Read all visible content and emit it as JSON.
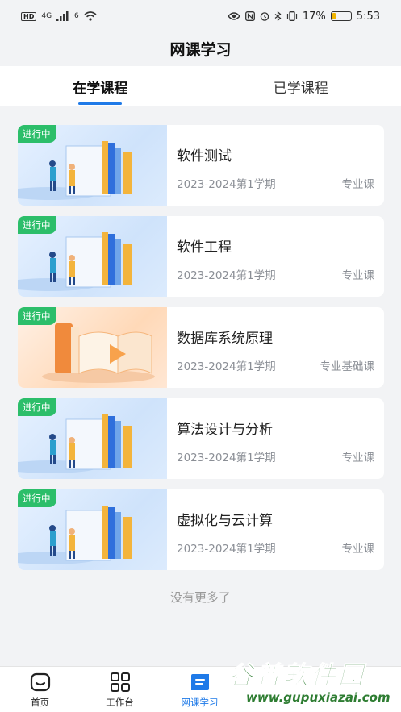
{
  "status_bar": {
    "hd": "HD",
    "net": "4G",
    "wifi_label": "6",
    "battery_percent": "17%",
    "battery_level": 0.17,
    "time": "5:53"
  },
  "header": {
    "title": "网课学习"
  },
  "tabs": [
    {
      "label": "在学课程",
      "active": true
    },
    {
      "label": "已学课程",
      "active": false
    }
  ],
  "courses": [
    {
      "status": "进行中",
      "name": "软件测试",
      "term": "2023-2024第1学期",
      "type": "专业课",
      "image": "books-illustration"
    },
    {
      "status": "进行中",
      "name": "软件工程",
      "term": "2023-2024第1学期",
      "type": "专业课",
      "image": "books-illustration"
    },
    {
      "status": "进行中",
      "name": "数据库系统原理",
      "term": "2023-2024第1学期",
      "type": "专业基础课",
      "image": "book-play-illustration"
    },
    {
      "status": "进行中",
      "name": "算法设计与分析",
      "term": "2023-2024第1学期",
      "type": "专业课",
      "image": "books-illustration"
    },
    {
      "status": "进行中",
      "name": "虚拟化与云计算",
      "term": "2023-2024第1学期",
      "type": "专业课",
      "image": "books-illustration"
    }
  ],
  "footer_text": "没有更多了",
  "bottom_nav": [
    {
      "label": "首页",
      "icon": "home-icon",
      "active": false
    },
    {
      "label": "工作台",
      "icon": "grid-icon",
      "active": false
    },
    {
      "label": "网课学习",
      "icon": "course-icon",
      "active": true
    },
    {
      "label": "",
      "icon": "",
      "active": false
    },
    {
      "label": "",
      "icon": "",
      "active": false
    }
  ],
  "watermark": {
    "title": "谷普软件园",
    "url": "www.gupuxiazai.com"
  },
  "colors": {
    "accent": "#1f7ae8",
    "status_green": "#2cbe6a",
    "background": "#f2f3f5"
  }
}
